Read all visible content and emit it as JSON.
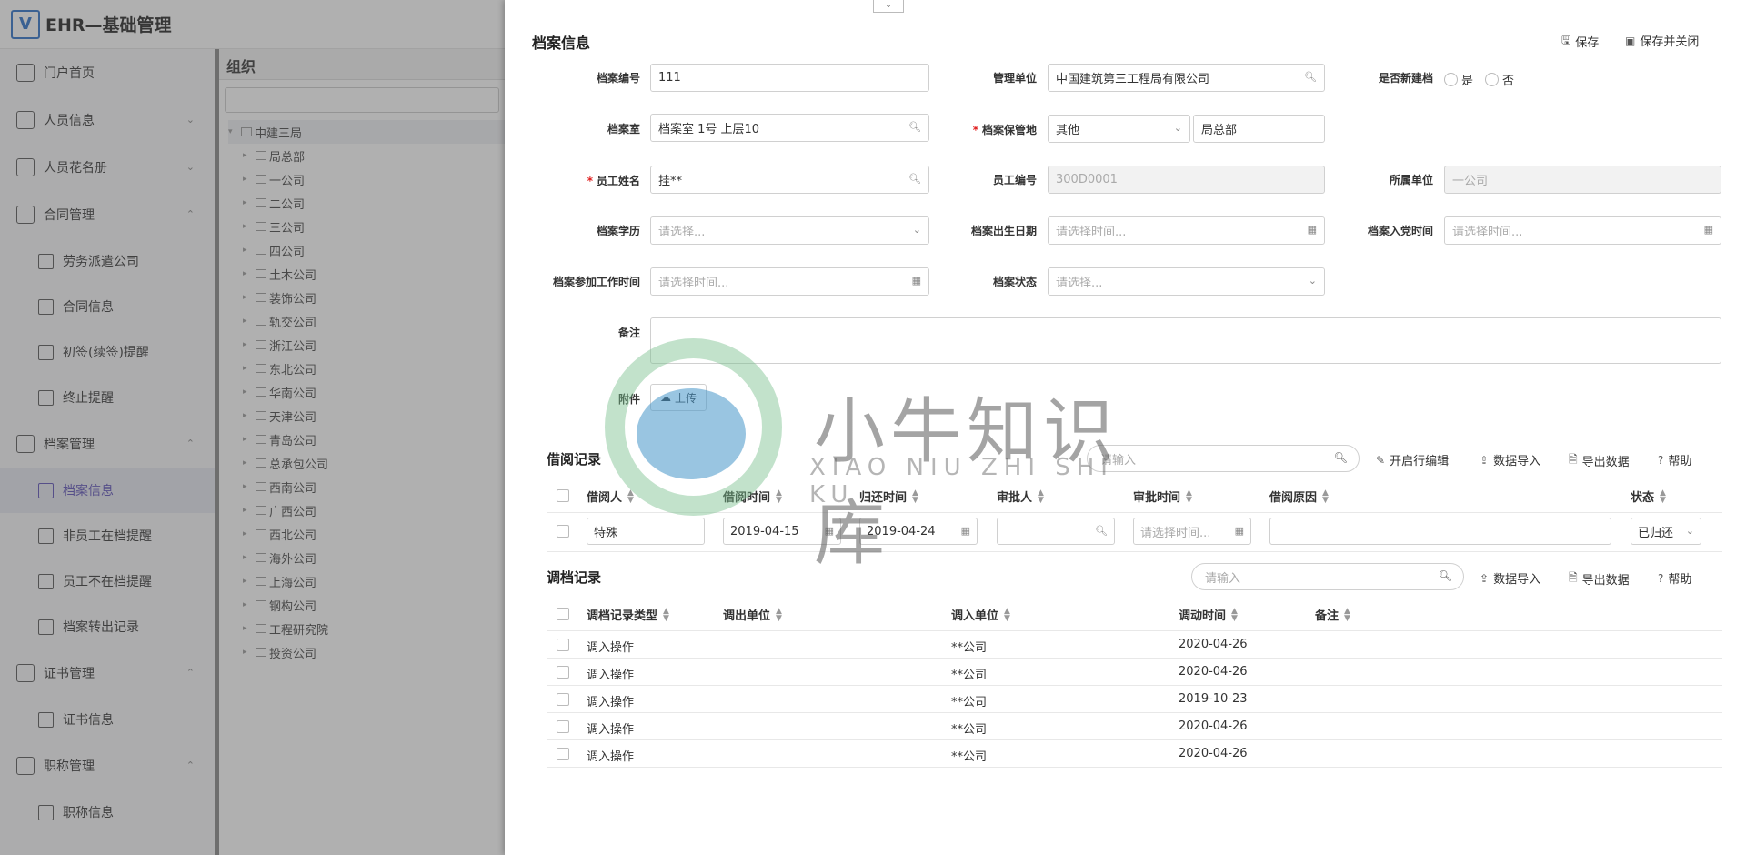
{
  "app": {
    "title": "EHR—基础管理"
  },
  "sidebar": {
    "items": [
      {
        "label": "门户首页",
        "type": "top"
      },
      {
        "label": "人员信息",
        "type": "group"
      },
      {
        "label": "人员花名册",
        "type": "group"
      },
      {
        "label": "合同管理",
        "type": "group-open"
      },
      {
        "label": "劳务派遣公司",
        "type": "sub"
      },
      {
        "label": "合同信息",
        "type": "sub"
      },
      {
        "label": "初签(续签)提醒",
        "type": "sub"
      },
      {
        "label": "终止提醒",
        "type": "sub"
      },
      {
        "label": "档案管理",
        "type": "group-open"
      },
      {
        "label": "档案信息",
        "type": "sub-active"
      },
      {
        "label": "非员工在档提醒",
        "type": "sub"
      },
      {
        "label": "员工不在档提醒",
        "type": "sub"
      },
      {
        "label": "档案转出记录",
        "type": "sub"
      },
      {
        "label": "证书管理",
        "type": "group-open"
      },
      {
        "label": "证书信息",
        "type": "sub"
      },
      {
        "label": "职称管理",
        "type": "group-open"
      },
      {
        "label": "职称信息",
        "type": "sub"
      }
    ]
  },
  "org": {
    "title": "组织",
    "root": "中建三局",
    "children": [
      "局总部",
      "一公司",
      "二公司",
      "三公司",
      "四公司",
      "土木公司",
      "装饰公司",
      "轨交公司",
      "浙江公司",
      "东北公司",
      "华南公司",
      "天津公司",
      "青岛公司",
      "总承包公司",
      "西南公司",
      "广西公司",
      "西北公司",
      "海外公司",
      "上海公司",
      "钢构公司",
      "工程研究院",
      "投资公司"
    ]
  },
  "drawer": {
    "title": "档案信息",
    "save": "保存",
    "save_close": "保存并关闭",
    "fields": {
      "file_no": {
        "label": "档案编号",
        "value": "111"
      },
      "mgmt_unit": {
        "label": "管理单位",
        "value": "中国建筑第三工程局有限公司"
      },
      "new_file": {
        "label": "是否新建档",
        "yes": "是",
        "no": "否"
      },
      "archive_room": {
        "label": "档案室",
        "value": "档案室 1号 上层10"
      },
      "storage_place": {
        "label": "档案保管地",
        "select": "其他",
        "value": "局总部"
      },
      "emp_name": {
        "label": "员工姓名",
        "value": "挂**"
      },
      "emp_no": {
        "label": "员工编号",
        "value": "300D0001"
      },
      "unit": {
        "label": "所属单位",
        "value": "一公司"
      },
      "education": {
        "label": "档案学历",
        "placeholder": "请选择..."
      },
      "birth": {
        "label": "档案出生日期",
        "placeholder": "请选择时间..."
      },
      "party": {
        "label": "档案入党时间",
        "placeholder": "请选择时间..."
      },
      "work_start": {
        "label": "档案参加工作时间",
        "placeholder": "请选择时间..."
      },
      "status": {
        "label": "档案状态",
        "placeholder": "请选择..."
      },
      "remark": {
        "label": "备注"
      },
      "attachment": {
        "label": "附件",
        "upload": "上传"
      }
    },
    "borrow": {
      "title": "借阅记录",
      "search_placeholder": "请输入",
      "actions": {
        "edit": "开启行编辑",
        "import": "数据导入",
        "export": "导出数据",
        "help": "帮助"
      },
      "columns": [
        "借阅人",
        "借阅时间",
        "归还时间",
        "审批人",
        "审批时间",
        "借阅原因",
        "状态"
      ],
      "row": {
        "borrower": "特殊",
        "borrow_time": "2019-04-15",
        "return_time": "2019-04-24",
        "approve_time_ph": "请选择时间...",
        "status": "已归还"
      }
    },
    "transfer": {
      "title": "调档记录",
      "search_placeholder": "请输入",
      "actions": {
        "import": "数据导入",
        "export": "导出数据",
        "help": "帮助"
      },
      "columns": [
        "调档记录类型",
        "调出单位",
        "调入单位",
        "调动时间",
        "备注"
      ],
      "rows": [
        {
          "type": "调入操作",
          "out": "",
          "in": "**公司",
          "time": "2020-04-26",
          "remark": ""
        },
        {
          "type": "调入操作",
          "out": "",
          "in": "**公司",
          "time": "2020-04-26",
          "remark": ""
        },
        {
          "type": "调入操作",
          "out": "",
          "in": "**公司",
          "time": "2019-10-23",
          "remark": ""
        },
        {
          "type": "调入操作",
          "out": "",
          "in": "**公司",
          "time": "2020-04-26",
          "remark": ""
        },
        {
          "type": "调入操作",
          "out": "",
          "in": "**公司",
          "time": "2020-04-26",
          "remark": ""
        }
      ]
    }
  },
  "watermark": {
    "cn": "小牛知识库",
    "en": "XIAO NIU ZHI SHI KU"
  }
}
